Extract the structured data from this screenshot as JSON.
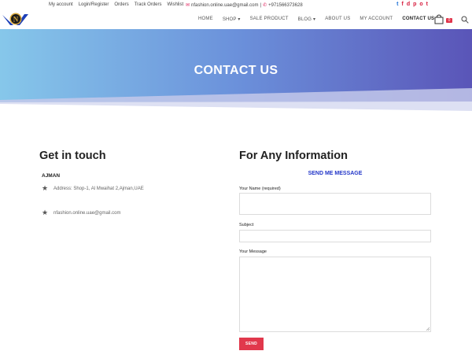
{
  "topbar": {
    "links": [
      "My account",
      "Login/Register",
      "Orders",
      "Track Orders",
      "Wishlist"
    ],
    "email": "nfashion.online.uae@gmail.com",
    "separator": "|",
    "phone": "+971566373628",
    "social_icons": [
      "twitter-icon",
      "facebook-icon",
      "dribbble-icon",
      "pinterest-icon",
      "instagram-icon",
      "tumblr-icon"
    ],
    "social_glyphs": [
      "t",
      "f",
      "d",
      "p",
      "o",
      "t"
    ]
  },
  "header": {
    "logo_letter": "N",
    "nav": [
      {
        "label": "HOME",
        "active": false
      },
      {
        "label": "SHOP ▾",
        "active": false
      },
      {
        "label": "SALE PRODUCT",
        "active": false
      },
      {
        "label": "BLOG ▾",
        "active": false
      },
      {
        "label": "ABOUT US",
        "active": false
      },
      {
        "label": "MY ACCOUNT",
        "active": false
      },
      {
        "label": "CONTACT US",
        "active": true
      }
    ],
    "cart_count": "0"
  },
  "hero": {
    "title": "CONTACT US"
  },
  "get_in_touch": {
    "heading": "Get in touch",
    "city": "AJMAN",
    "address": "Address: Shop-1, Al Mwaihat 2,Ajman,UAE",
    "email": "nfashion.online.uae@gmail.com"
  },
  "form": {
    "heading": "For Any Information",
    "subheading": "SEND ME MESSAGE",
    "name_label": "Your Name (required)",
    "name_value": "",
    "subject_label": "Subject",
    "subject_value": "",
    "message_label": "Your Message",
    "message_value": "",
    "send_label": "SEND"
  },
  "colors": {
    "accent": "#e1384c",
    "link_blue": "#2236c8",
    "hero_start": "#86c7ea",
    "hero_end": "#5a55b8"
  }
}
